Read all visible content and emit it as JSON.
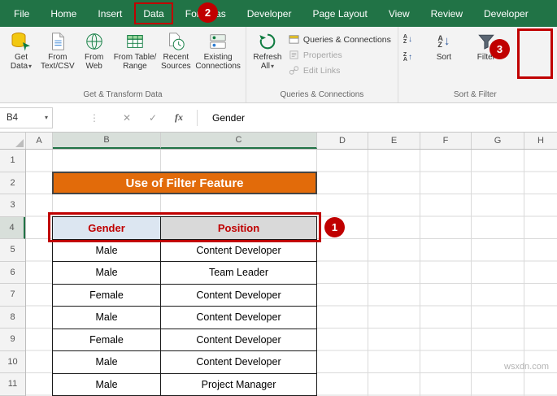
{
  "colors": {
    "excel_green": "#217346",
    "annotation_red": "#c00000",
    "banner_orange": "#e26b0a",
    "header_text_red": "#c00000",
    "header_fill_b4": "#dce6f1",
    "header_fill_c4": "#d9d9d9"
  },
  "icons": {
    "dropdown": "▾",
    "vertical_dots": "⋮",
    "cancel": "✕",
    "enter": "✓",
    "fx": "fx",
    "sort_a": "A",
    "sort_z": "Z",
    "arrow_down": "↓",
    "arrow_up": "↑"
  },
  "tabbar": {
    "tabs": [
      "File",
      "Home",
      "Insert",
      "Data",
      "Formulas",
      "Developer",
      "Page Layout",
      "View",
      "Review",
      "Developer"
    ],
    "active_tab": "Data"
  },
  "ribbon": {
    "groups": [
      {
        "label": "Get & Transform Data"
      },
      {
        "label": "Queries & Connections"
      },
      {
        "label": "Sort & Filter"
      }
    ],
    "buttons": {
      "get_data": {
        "line1": "Get",
        "line2": "Data"
      },
      "from_text_csv": {
        "line1": "From",
        "line2": "Text/CSV"
      },
      "from_web": {
        "line1": "From",
        "line2": "Web"
      },
      "from_table_range": {
        "line1": "From Table/",
        "line2": "Range"
      },
      "recent_sources": {
        "line1": "Recent",
        "line2": "Sources"
      },
      "existing_connections": {
        "line1": "Existing",
        "line2": "Connections"
      },
      "refresh_all": {
        "line1": "Refresh",
        "line2": "All"
      },
      "queries_connections": {
        "label": "Queries & Connections"
      },
      "properties": {
        "label": "Properties"
      },
      "edit_links": {
        "label": "Edit Links"
      },
      "sort": {
        "label": "Sort"
      },
      "filter": {
        "label": "Filter"
      }
    }
  },
  "formula_bar": {
    "name_box": "B4",
    "formula": "Gender"
  },
  "sheet": {
    "columns": [
      "A",
      "B",
      "C",
      "D",
      "E",
      "F",
      "G",
      "H"
    ],
    "rows": [
      "1",
      "2",
      "3",
      "4",
      "5",
      "6",
      "7",
      "8",
      "9",
      "10",
      "11"
    ],
    "banner": "Use of Filter Feature",
    "table": {
      "headers": [
        "Gender",
        "Position"
      ],
      "rows": [
        [
          "Male",
          "Content Developer"
        ],
        [
          "Male",
          "Team Leader"
        ],
        [
          "Female",
          "Content Developer"
        ],
        [
          "Male",
          "Content Developer"
        ],
        [
          "Female",
          "Content Developer"
        ],
        [
          "Male",
          "Content Developer"
        ],
        [
          "Male",
          "Project Manager"
        ]
      ]
    }
  },
  "annotations": {
    "step1": "1",
    "step2": "2",
    "step3": "3"
  },
  "watermark": "wsxdn.com"
}
